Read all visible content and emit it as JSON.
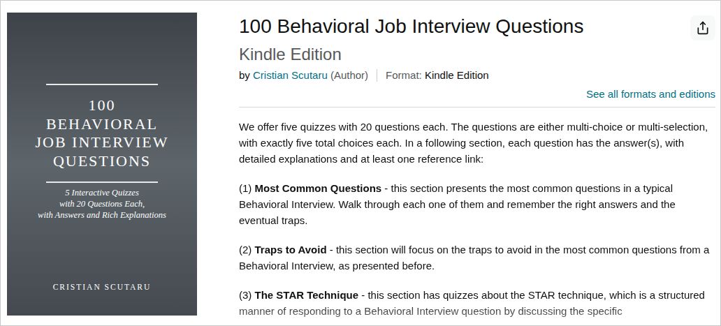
{
  "cover": {
    "title_lines": [
      "100",
      "BEHAVIORAL",
      "JOB INTERVIEW",
      "QUESTIONS"
    ],
    "subtitle_lines": [
      "5 Interactive Quizzes",
      "with 20 Questions Each,",
      "with Answers and Rich Explanations"
    ],
    "author": "CRISTIAN SCUTARU"
  },
  "product": {
    "title": "100 Behavioral Job Interview Questions",
    "edition": "Kindle Edition",
    "by": "by ",
    "author": "Cristian Scutaru",
    "role": " (Author)",
    "format_label": "Format: ",
    "format": "Kindle Edition",
    "see_all": "See all formats and editions"
  },
  "description": {
    "intro": "We offer five quizzes with 20 questions each. The questions are either multi-choice or multi-selection, with exactly five total choices each. In a following section, each question has the answer(s), with detailed explanations and at least one reference link:",
    "sections": [
      {
        "prefix": "(1) ",
        "title": "Most Common Questions",
        "text": " - this section presents the most common questions in a typical Behavioral Interview. Walk through each one of them and remember the right answers and the eventual traps."
      },
      {
        "prefix": "(2) ",
        "title": "Traps to Avoid",
        "text": " - this section will focus on the traps to avoid in the most common questions from a Behavioral Interview, as presented before."
      },
      {
        "prefix": "(3) ",
        "title": "The STAR Technique",
        "text": " - this section has quizzes about the STAR technique, which is a structured manner of responding to a Behavioral Interview question by discussing the specific"
      }
    ]
  }
}
